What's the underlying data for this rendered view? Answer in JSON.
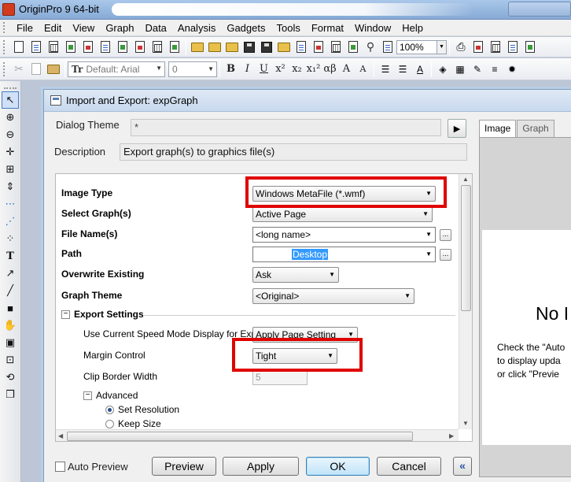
{
  "app": {
    "title": "OriginPro 9 64-bit"
  },
  "menu": [
    "File",
    "Edit",
    "View",
    "Graph",
    "Data",
    "Analysis",
    "Gadgets",
    "Tools",
    "Format",
    "Window",
    "Help"
  ],
  "toolbar": {
    "zoom": "100%",
    "font": "Default: Arial",
    "font_size": "0",
    "format_glyphs": [
      "B",
      "I",
      "U",
      "x²",
      "x₂",
      "x₁²",
      "αβ",
      "A",
      "A"
    ]
  },
  "dialog": {
    "title": "Import and Export: expGraph",
    "theme_label": "Dialog Theme",
    "theme_value": "*",
    "description_label": "Description",
    "description_value": "Export graph(s) to graphics file(s)",
    "tabs": [
      "Image",
      "Graph"
    ],
    "preview": {
      "big_text": "No I",
      "hint": "Check the \"Auto\nto display upda\nor click \"Previe"
    },
    "rows": {
      "image_type": {
        "label": "Image Type",
        "value": "Windows MetaFile (*.wmf)"
      },
      "select_graph": {
        "label": "Select Graph(s)",
        "value": "Active Page"
      },
      "file_name": {
        "label": "File Name(s)",
        "value": "<long name>"
      },
      "path": {
        "label": "Path",
        "value": "Desktop"
      },
      "overwrite": {
        "label": "Overwrite Existing",
        "value": "Ask"
      },
      "graph_theme": {
        "label": "Graph Theme",
        "value": "<Original>"
      },
      "export_settings": {
        "label": "Export Settings"
      },
      "speed_mode": {
        "label": "Use Current Speed Mode Display for Export",
        "value": "Apply Page Setting"
      },
      "margin": {
        "label": "Margin Control",
        "value": "Tight"
      },
      "clip_border": {
        "label": "Clip Border Width",
        "value": "5"
      },
      "advanced": {
        "label": "Advanced"
      },
      "set_resolution": {
        "label": "Set Resolution"
      },
      "keep_size": {
        "label": "Keep Size"
      }
    },
    "bottom": {
      "auto_preview": "Auto Preview",
      "preview": "Preview",
      "apply": "Apply",
      "ok": "OK",
      "cancel": "Cancel",
      "collapse": "«"
    }
  },
  "colors": {
    "highlight": "#e00000",
    "title_bar": "#a9c7e9"
  }
}
